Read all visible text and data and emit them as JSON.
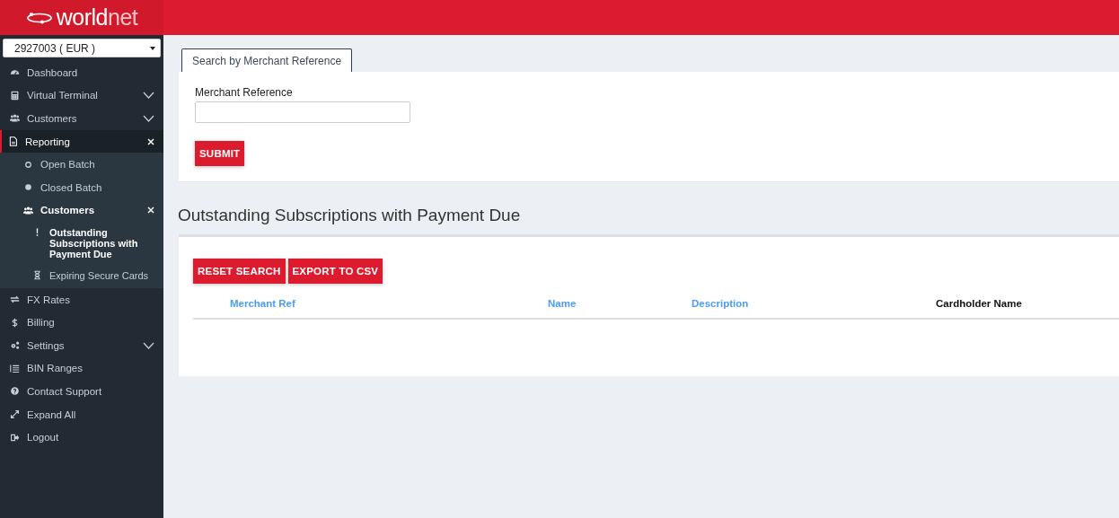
{
  "header": {
    "logo": [
      "world",
      "net"
    ]
  },
  "sidebar": {
    "account": "2927003 ( EUR )",
    "items": [
      {
        "label": "Dashboard",
        "kind": "gauge",
        "selected": false
      },
      {
        "label": "Virtual Terminal",
        "kind": "calculator",
        "selected": false,
        "expanded": false
      },
      {
        "label": "Customers",
        "kind": "users",
        "selected": false,
        "expanded": false
      },
      {
        "label": "Reporting",
        "kind": "document",
        "selected": true,
        "expanded": true,
        "children": [
          {
            "label": "Open Batch",
            "kind": "ring",
            "selected": false
          },
          {
            "label": "Closed Batch",
            "kind": "dot",
            "selected": false
          },
          {
            "label": "Customers",
            "kind": "users",
            "selected": true,
            "expanded": true,
            "children": [
              {
                "label": "Outstanding Subscriptions with Payment Due",
                "kind": "exclaim",
                "selected": true
              },
              {
                "label": "Expiring Secure Cards",
                "kind": "hourglass",
                "selected": false
              }
            ]
          }
        ]
      },
      {
        "label": "FX Rates",
        "kind": "exchange",
        "selected": false
      },
      {
        "label": "Billing",
        "kind": "dollar",
        "selected": false
      },
      {
        "label": "Settings",
        "kind": "gears",
        "selected": false,
        "expanded": false
      },
      {
        "label": "BIN Ranges",
        "kind": "list",
        "selected": false
      },
      {
        "label": "Contact Support",
        "kind": "question",
        "selected": false
      },
      {
        "label": "Expand All",
        "kind": "expand",
        "selected": false
      },
      {
        "label": "Logout",
        "kind": "logout",
        "selected": false
      }
    ]
  },
  "search": {
    "tabs": [
      {
        "label": "Search by Merchant Reference",
        "selected": true
      }
    ],
    "field_label": "Merchant Reference",
    "submit": "SUBMIT"
  },
  "results": {
    "title": "Outstanding Subscriptions with Payment Due",
    "buttons": [
      "RESET SEARCH",
      "EXPORT TO CSV"
    ],
    "columns": [
      {
        "label": "Merchant Ref",
        "link": true
      },
      {
        "label": "Name",
        "link": true
      },
      {
        "label": "Description",
        "link": true
      },
      {
        "label": "Cardholder Name",
        "link": false
      }
    ]
  }
}
